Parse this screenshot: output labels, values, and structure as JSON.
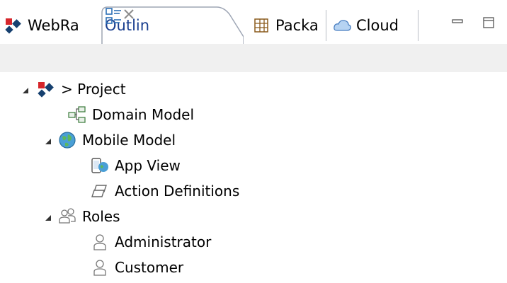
{
  "tabs": [
    {
      "label": "WebRa",
      "icon": "webratio-logo-icon"
    },
    {
      "label": "Outlin",
      "icon": "outline-icon",
      "active": true
    },
    {
      "label": "Packa",
      "icon": "package-icon"
    },
    {
      "label": "Cloud",
      "icon": "cloud-icon"
    }
  ],
  "window_controls": {
    "minimize": "minimize-icon",
    "maximize": "maximize-icon"
  },
  "tree": {
    "project": {
      "label": "> Project",
      "icon": "webratio-logo-icon"
    },
    "domain_model": {
      "label": "Domain Model",
      "icon": "domain-model-icon"
    },
    "mobile_model": {
      "label": "Mobile Model",
      "icon": "globe-icon"
    },
    "app_view": {
      "label": "App View",
      "icon": "mobile-app-view-icon"
    },
    "action_definitions": {
      "label": "Action Definitions",
      "icon": "action-definitions-icon"
    },
    "roles": {
      "label": "Roles",
      "icon": "users-icon"
    },
    "administrator": {
      "label": "Administrator",
      "icon": "user-icon"
    },
    "customer": {
      "label": "Customer",
      "icon": "user-icon"
    }
  },
  "colors": {
    "toolbar_strip": "#f0f0f0",
    "tab_border": "#b8bcc4",
    "active_tab_bg": "#ffffff"
  }
}
